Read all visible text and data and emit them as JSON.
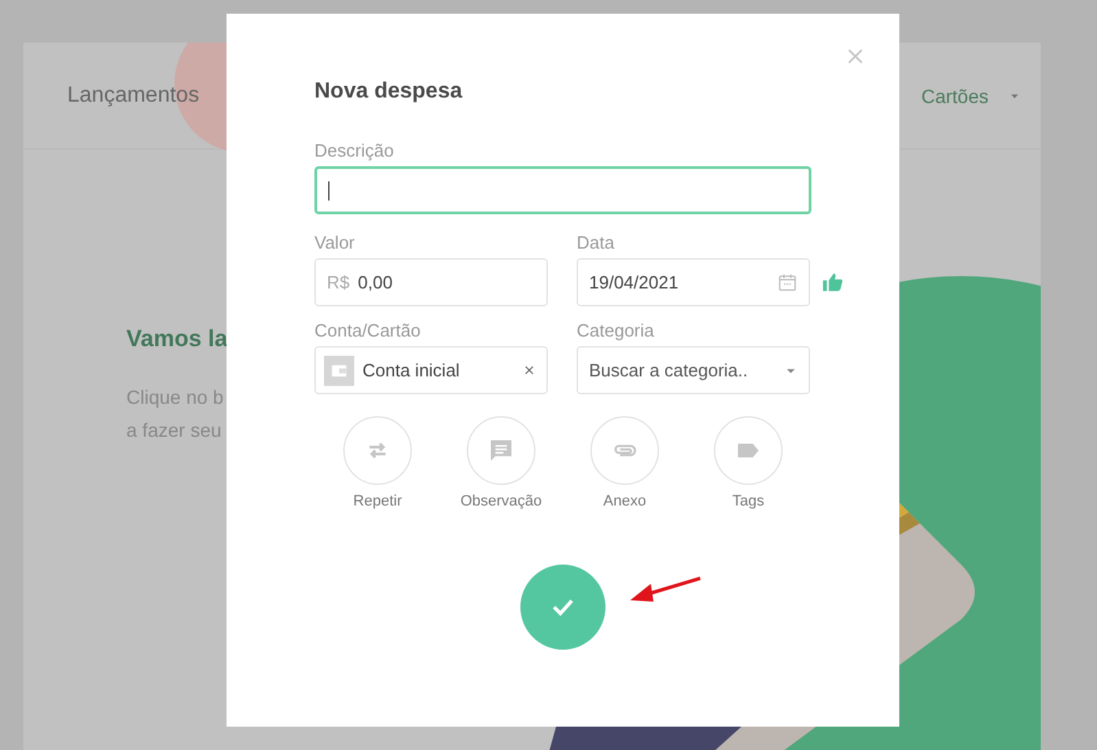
{
  "background": {
    "nav": [
      {
        "label": "Lançamentos",
        "kind": "plain"
      },
      {
        "label": "Cartões",
        "kind": "dropdown"
      }
    ],
    "intro_title": "Vamos la",
    "intro_lines": [
      "Clique no b",
      "a fazer seu"
    ]
  },
  "modal": {
    "title": "Nova despesa",
    "description": {
      "label": "Descrição",
      "focused": true
    },
    "amount": {
      "label": "Valor",
      "prefix": "R$",
      "value": "0,00"
    },
    "date": {
      "label": "Data",
      "value": "19/04/2021"
    },
    "account": {
      "label": "Conta/Cartão",
      "value": "Conta inicial"
    },
    "category": {
      "label": "Categoria",
      "placeholder": "Buscar a categoria.."
    },
    "actions": [
      {
        "label": "Repetir",
        "kind": "repeat"
      },
      {
        "label": "Observação",
        "kind": "note"
      },
      {
        "label": "Anexo",
        "kind": "attach"
      },
      {
        "label": "Tags",
        "kind": "tag"
      }
    ]
  }
}
